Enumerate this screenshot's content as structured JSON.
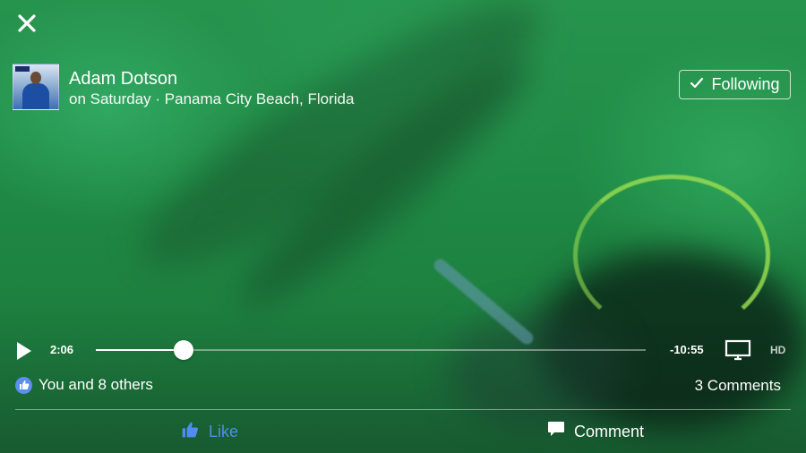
{
  "post": {
    "author": "Adam Dotson",
    "subtitle": "on Saturday · Panama City Beach, Florida",
    "follow_label": "Following"
  },
  "player": {
    "current_time": "2:06",
    "remaining_time": "-10:55",
    "progress": 0.16,
    "quality_label": "HD"
  },
  "reactions": {
    "likes_text": "You and 8 others",
    "comments_text": "3 Comments"
  },
  "actions": {
    "like_label": "Like",
    "comment_label": "Comment"
  },
  "colors": {
    "like_blue": "#4f8df2",
    "badge_blue": "#5a8ff0"
  },
  "icons": {
    "close": "close-icon",
    "check": "check-icon",
    "play": "play-icon",
    "tv": "tv-icon",
    "thumbs_up": "thumbs-up-icon",
    "comment": "comment-bubble-icon"
  }
}
